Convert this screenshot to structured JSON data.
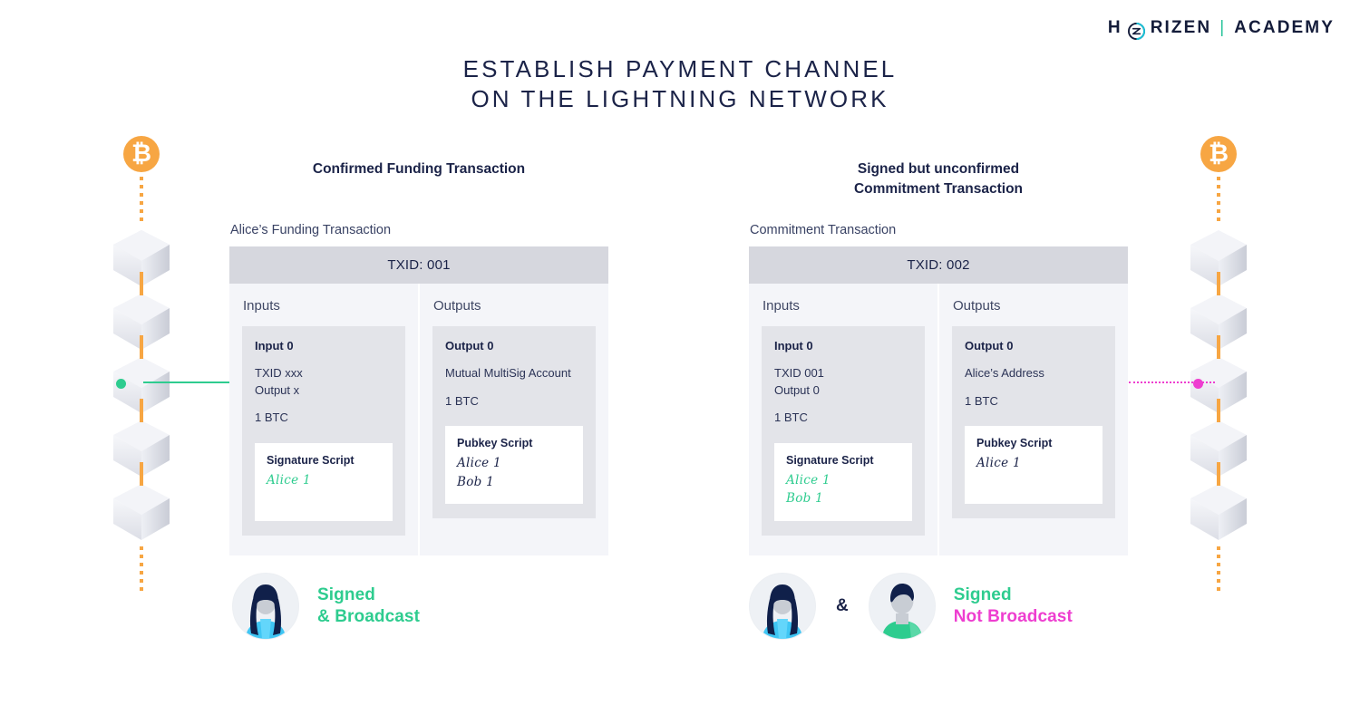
{
  "brand": {
    "part1": "H",
    "mark": "horizen-logo-icon",
    "part2": "RIZEN",
    "separator": "|",
    "part3": "ACADEMY"
  },
  "title": {
    "line1": "ESTABLISH PAYMENT CHANNEL",
    "line2": "ON THE LIGHTNING NETWORK"
  },
  "columns": {
    "left": {
      "heading": "Confirmed Funding Transaction",
      "caption": "Alice’s Funding Transaction",
      "txid": "TXID: 001",
      "inputs_title": "Inputs",
      "outputs_title": "Outputs",
      "input": {
        "title": "Input 0",
        "ref_line1": "TXID xxx",
        "ref_line2": "Output x",
        "amount": "1 BTC",
        "script_title": "Signature Script",
        "signatures": [
          {
            "text": "Alice 1",
            "color": "green"
          }
        ]
      },
      "output": {
        "title": "Output 0",
        "ref_line1": "Mutual MultiSig Account",
        "ref_line2": "",
        "amount": "1 BTC",
        "script_title": "Pubkey Script",
        "signatures": [
          {
            "text": "Alice 1",
            "color": "dark"
          },
          {
            "text": "Bob 1",
            "color": "dark"
          }
        ]
      },
      "actors": [
        {
          "name": "alice"
        }
      ],
      "status_line1": "Signed",
      "status_line2": "& Broadcast",
      "status_line1_color": "#2ecc8f",
      "status_line2_color": "#2ecc8f"
    },
    "right": {
      "heading_line1": "Signed but unconfirmed",
      "heading_line2": "Commitment Transaction",
      "caption": "Commitment Transaction",
      "txid": "TXID: 002",
      "inputs_title": "Inputs",
      "outputs_title": "Outputs",
      "input": {
        "title": "Input 0",
        "ref_line1": "TXID 001",
        "ref_line2": "Output 0",
        "amount": "1 BTC",
        "script_title": "Signature Script",
        "signatures": [
          {
            "text": "Alice 1",
            "color": "green"
          },
          {
            "text": "Bob 1",
            "color": "green"
          }
        ]
      },
      "output": {
        "title": "Output 0",
        "ref_line1": "Alice’s Address",
        "ref_line2": "",
        "amount": "1 BTC",
        "script_title": "Pubkey Script",
        "signatures": [
          {
            "text": "Alice 1",
            "color": "dark"
          }
        ]
      },
      "actors": [
        {
          "name": "alice"
        },
        {
          "name": "bob"
        }
      ],
      "ampersand": "&",
      "status_line1": "Signed",
      "status_line2": "Not Broadcast",
      "status_line1_color": "#2ecc8f",
      "status_line2_color": "#ee3ed0"
    }
  },
  "chains": {
    "left": {
      "coin_icon": "bitcoin-icon",
      "coin_symbol": "₿",
      "block_count": 5,
      "marker_index": 2,
      "marker_color": "#2ecc8f"
    },
    "right": {
      "coin_icon": "bitcoin-icon",
      "coin_symbol": "₿",
      "block_count": 5,
      "marker_index": 2,
      "marker_color": "#ee3ed0"
    }
  },
  "connectors": {
    "left_color": "#2ecc8f",
    "left_style": "solid",
    "right_color": "#ee3ed0",
    "right_style": "dotted"
  },
  "palette": {
    "accent_orange": "#f7a643",
    "accent_green": "#2ecc8f",
    "accent_pink": "#ee3ed0",
    "ink": "#1b2348"
  }
}
